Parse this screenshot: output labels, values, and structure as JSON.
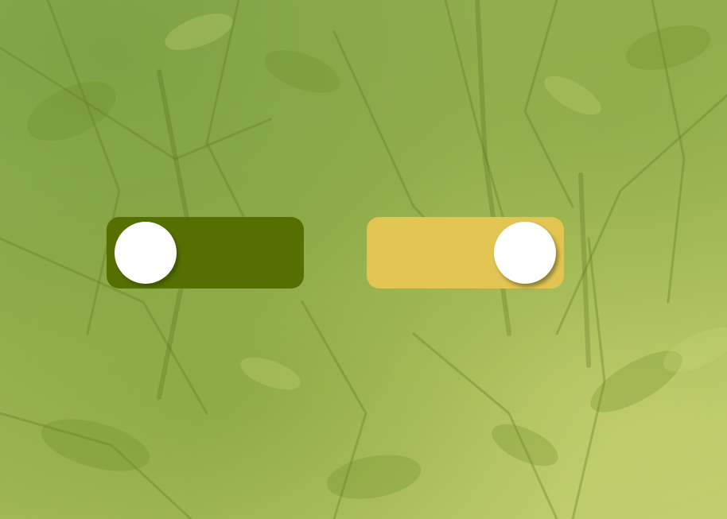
{
  "background": {
    "icon": "foliage-background",
    "base_color": "#96b050"
  },
  "toggles": [
    {
      "name": "toggle-switch-off",
      "state": "off",
      "track_color": "#557000",
      "knob_color": "#ffffff"
    },
    {
      "name": "toggle-switch-on",
      "state": "on",
      "track_color": "#e2c453",
      "knob_color": "#ffffff"
    }
  ]
}
